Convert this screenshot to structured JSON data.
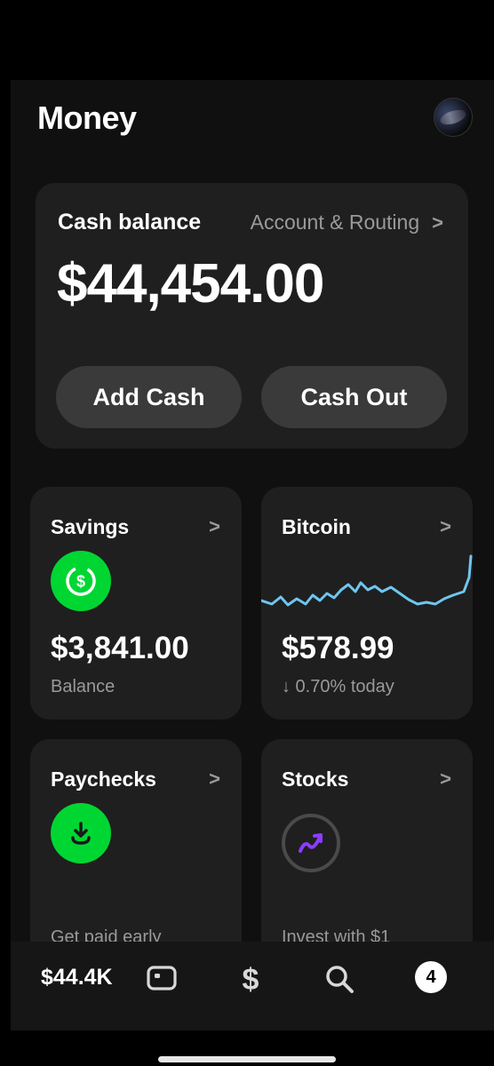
{
  "header": {
    "title": "Money"
  },
  "cash_card": {
    "label": "Cash balance",
    "routing_label": "Account & Routing",
    "balance": "$44,454.00",
    "add_cash_label": "Add Cash",
    "cash_out_label": "Cash Out"
  },
  "tiles": {
    "savings": {
      "title": "Savings",
      "amount": "$3,841.00",
      "subtitle": "Balance",
      "icon": "savings-dollar-icon"
    },
    "bitcoin": {
      "title": "Bitcoin",
      "amount": "$578.99",
      "change": "↓ 0.70% today",
      "accent": "#6ec6f0"
    },
    "paychecks": {
      "title": "Paychecks",
      "footer": "Get paid early",
      "icon": "download-icon"
    },
    "stocks": {
      "title": "Stocks",
      "footer": "Invest with $1",
      "icon": "trend-up-icon",
      "accent": "#8b3dff"
    }
  },
  "bottom_nav": {
    "balance": "$44.4K",
    "badge_count": "4",
    "icons": [
      "card-icon",
      "dollar-icon",
      "search-icon",
      "activity-badge"
    ]
  },
  "colors": {
    "brand_green": "#00d632",
    "background": "#101010",
    "card": "#1f1f1f"
  }
}
